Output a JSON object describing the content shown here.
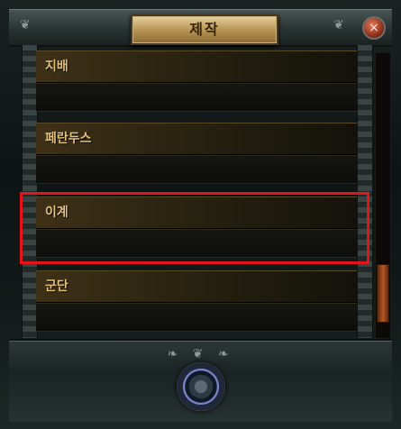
{
  "window": {
    "title": "제작",
    "close_symbol": "×"
  },
  "crafting_list": {
    "items": [
      {
        "label": "지배"
      },
      {
        "label": "페란두스"
      },
      {
        "label": "이계",
        "highlighted": true
      },
      {
        "label": "군단"
      }
    ]
  },
  "icons": {
    "close": "close-icon",
    "craft": "craft-orb-icon"
  },
  "colors": {
    "accent_gold": "#e3c27a",
    "highlight_red": "#e3141a",
    "scroll_thumb": "#b65624"
  },
  "scroll": {
    "position_fraction": 0.85
  }
}
